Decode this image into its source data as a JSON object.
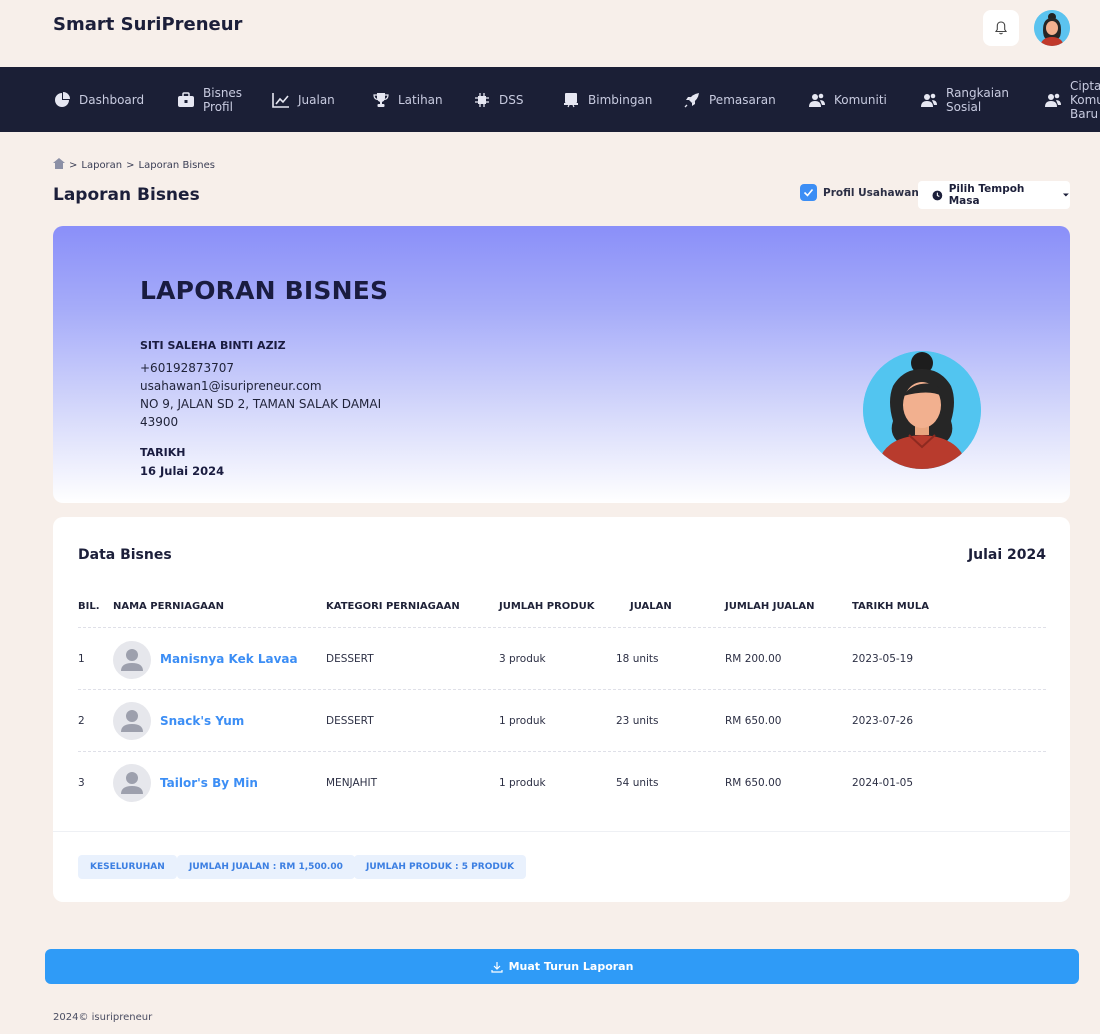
{
  "app": {
    "brand": "Smart SuriPreneur"
  },
  "nav": {
    "items": [
      {
        "label": "Dashboard",
        "icon": "pie-chart-icon"
      },
      {
        "label": "Bisnes\nProfil",
        "icon": "briefcase-icon"
      },
      {
        "label": "Jualan",
        "icon": "bar-chart-icon"
      },
      {
        "label": "Latihan",
        "icon": "trophy-icon"
      },
      {
        "label": "DSS",
        "icon": "chip-icon"
      },
      {
        "label": "Bimbingan",
        "icon": "presentation-icon"
      },
      {
        "label": "Pemasaran",
        "icon": "rocket-icon"
      },
      {
        "label": "Komuniti",
        "icon": "users-icon"
      },
      {
        "label": "Rangkaian\nSosial",
        "icon": "users-icon"
      },
      {
        "label": "Cipta\nKomu\nBaru",
        "icon": "users-icon"
      }
    ]
  },
  "breadcrumb": {
    "home_icon": "home-icon",
    "items": [
      "Laporan",
      "Laporan Bisnes"
    ],
    "separator": ">"
  },
  "page": {
    "title": "Laporan Bisnes",
    "profile_toggle_label": "Profil Usahawan",
    "profile_toggle_checked": true,
    "period_button_label": "Pilih Tempoh Masa"
  },
  "report": {
    "title": "LAPORAN BISNES",
    "name": "SITI SALEHA BINTI AZIZ",
    "phone": "+60192873707",
    "email": "usahawan1@isuripreneur.com",
    "address_line": "NO 9, JALAN SD 2, TAMAN SALAK DAMAI",
    "postcode": "43900",
    "date_label": "TARIKH",
    "date_value": "16 Julai 2024"
  },
  "data_card": {
    "title": "Data Bisnes",
    "month": "Julai 2024",
    "columns": [
      "BIL.",
      "NAMA PERNIAGAAN",
      "KATEGORI PERNIAGAAN",
      "JUMLAH PRODUK",
      "JUALAN",
      "JUMLAH JUALAN",
      "TARIKH MULA"
    ],
    "rows": [
      {
        "no": "1",
        "name": "Manisnya Kek Lavaa",
        "category": "DESSERT",
        "products": "3 produk",
        "sales": "18 units",
        "total": "RM 200.00",
        "start": "2023-05-19"
      },
      {
        "no": "2",
        "name": "Snack's Yum",
        "category": "DESSERT",
        "products": "1 produk",
        "sales": "23 units",
        "total": "RM 650.00",
        "start": "2023-07-26"
      },
      {
        "no": "3",
        "name": "Tailor's By Min",
        "category": "MENJAHIT",
        "products": "1 produk",
        "sales": "54 units",
        "total": "RM 650.00",
        "start": "2024-01-05"
      }
    ],
    "summary": [
      "KESELURUHAN",
      "JUMLAH JUALAN : RM 1,500.00",
      "JUMLAH PRODUK : 5 PRODUK"
    ]
  },
  "download_label": "Muat Turun Laporan",
  "footer": "2024© isuripreneur",
  "colors": {
    "nav_bg": "#1b1f36",
    "accent": "#3c8ef5",
    "download": "#2f9bf7",
    "page_bg": "#f7efea"
  }
}
